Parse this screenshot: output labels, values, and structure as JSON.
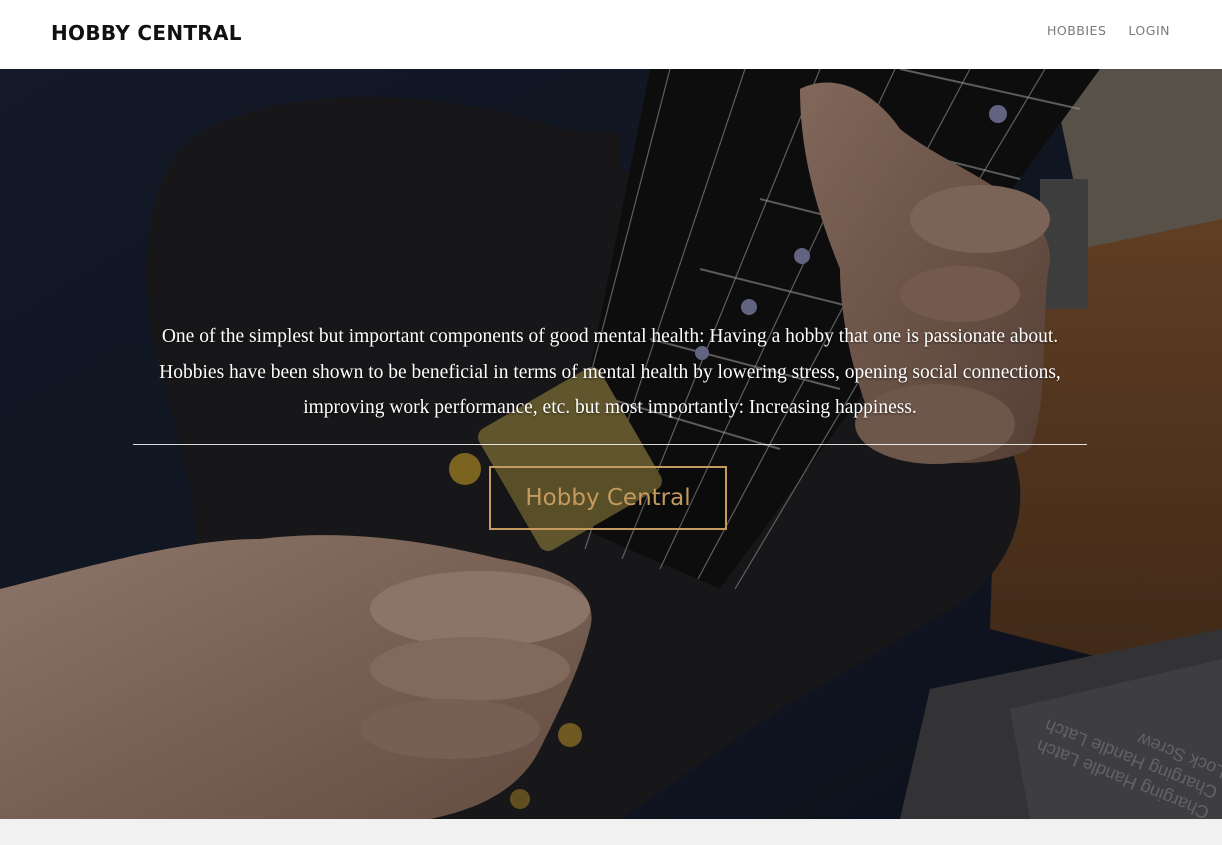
{
  "nav": {
    "brand": "HOBBY CENTRAL",
    "links": [
      {
        "label": "HOBBIES"
      },
      {
        "label": "LOGIN"
      }
    ]
  },
  "hero": {
    "background_image": "guitar-playing-photo",
    "paragraph": "One of the simplest but important components of good mental health: Having a hobby that one is passionate about. Hobbies have been shown to be beneficial in terms of mental health by lowering stress, opening social connections, improving work performance, etc. but most importantly: Increasing happiness.",
    "cta_label": "Hobby Central",
    "cta_color": "#c49a5e"
  }
}
